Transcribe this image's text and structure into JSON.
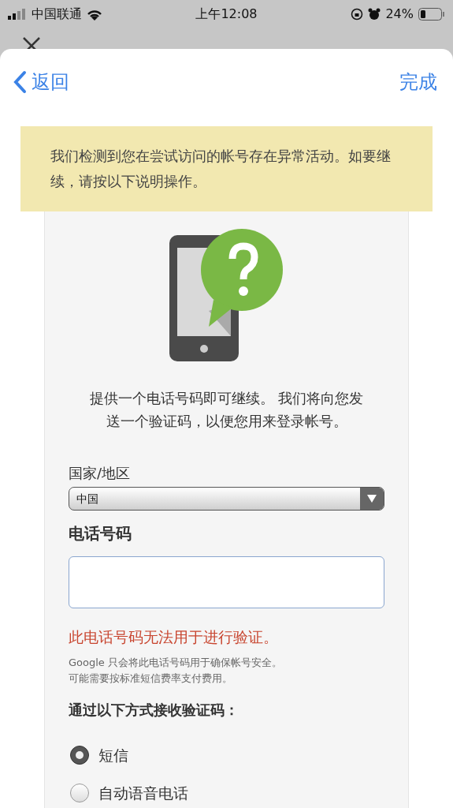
{
  "status_bar": {
    "carrier": "中国联通",
    "time": "上午12:08",
    "battery": "24%"
  },
  "nav": {
    "back": "返回",
    "done": "完成"
  },
  "banner": "我们检测到您在尝试访问的帐号存在异常活动。如要继续，请按以下说明操作。",
  "intro": "提供一个电话号码即可继续。 我们将向您发送一个验证码，以便您用来登录帐号。",
  "country": {
    "label": "国家/地区",
    "value": "中国"
  },
  "phone": {
    "label": "电话号码"
  },
  "error": "此电话号码无法用于进行验证。",
  "note": [
    "Google 只会将此电话号码用于确保帐号安全。",
    "可能需要按标准短信费率支付费用。"
  ],
  "method_heading": "通过以下方式接收验证码：",
  "methods": [
    {
      "label": "短信",
      "selected": true
    },
    {
      "label": "自动语音电话",
      "selected": false
    }
  ]
}
